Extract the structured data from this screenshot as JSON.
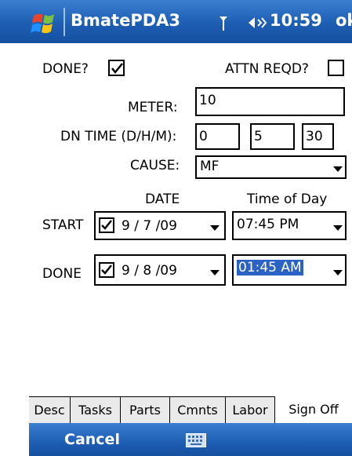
{
  "titlebar": {
    "app_title": "BmatePDA3",
    "time": "10:59",
    "ok_label": "ok"
  },
  "form": {
    "done_label": "DONE?",
    "done_checked": true,
    "attn_label": "ATTN REQD?",
    "attn_checked": false,
    "meter_label": "METER:",
    "meter_value": "10",
    "dn_time_label": "DN TIME (D/H/M):",
    "dn_days": "0",
    "dn_hours": "5",
    "dn_minutes": "30",
    "cause_label": "CAUSE:",
    "cause_value": "MF",
    "date_header": "DATE",
    "time_header": "Time of Day",
    "start_label": "START",
    "start_date_checked": true,
    "start_date": "9 / 7 /09",
    "start_time": "07:45 PM",
    "done_row_label": "DONE",
    "done_date_checked": true,
    "done_date": "9 / 8 /09",
    "done_time": "01:45 AM"
  },
  "tabs": [
    {
      "label": "Desc"
    },
    {
      "label": "Tasks"
    },
    {
      "label": "Parts"
    },
    {
      "label": "Cmnts"
    },
    {
      "label": "Labor"
    },
    {
      "label": "Sign Off",
      "active": true
    }
  ],
  "softbar": {
    "cancel_label": "Cancel"
  },
  "icons": {
    "start": "windows-flag-icon",
    "signal": "signal-icon",
    "volume": "volume-icon",
    "keyboard": "keyboard-icon"
  }
}
